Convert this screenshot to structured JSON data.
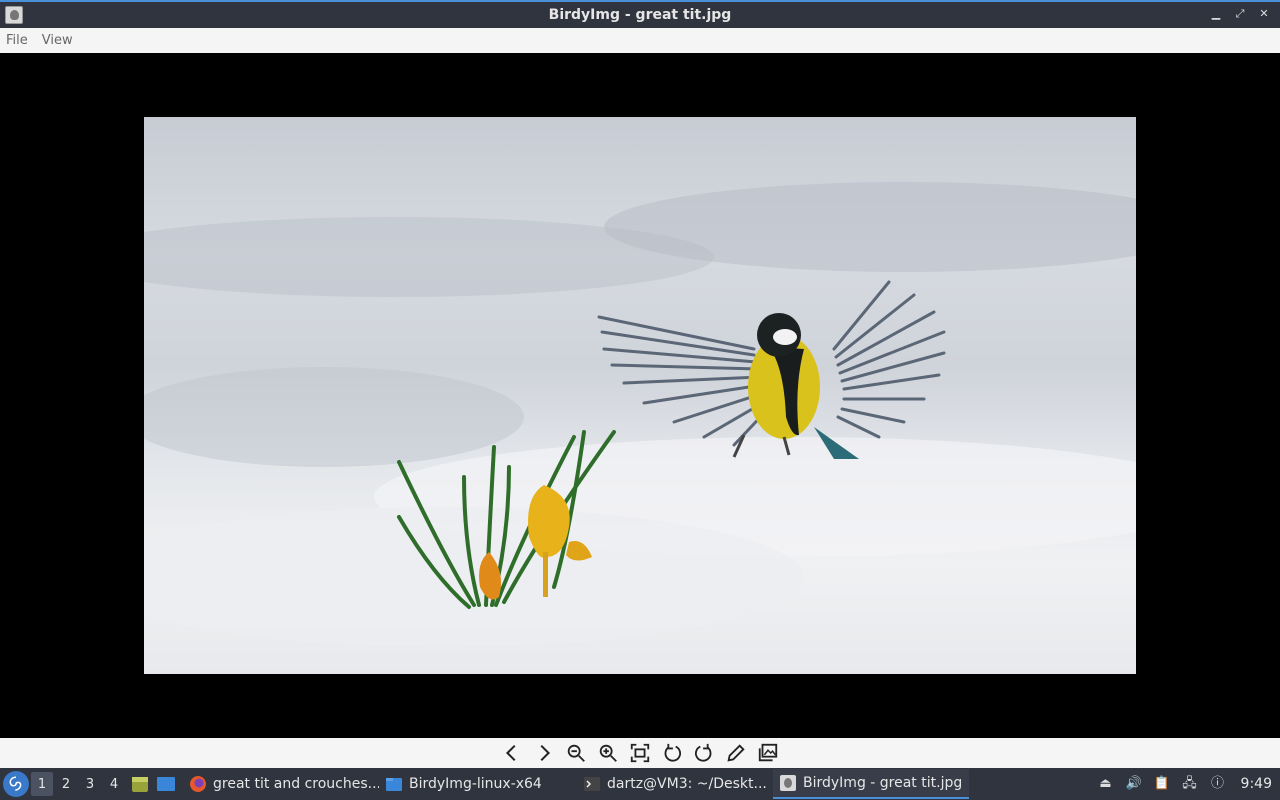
{
  "window": {
    "title": "BirdyImg - great tit.jpg",
    "icons": {
      "app": "birdyimg-app-icon",
      "minimize": "minimize-icon",
      "maximize": "maximize-icon",
      "close": "close-icon"
    }
  },
  "menubar": {
    "items": [
      "File",
      "View"
    ]
  },
  "toolbar": {
    "icons": [
      "prev-arrow-icon",
      "next-arrow-icon",
      "zoom-out-icon",
      "zoom-in-icon",
      "fit-window-icon",
      "rotate-left-icon",
      "rotate-right-icon",
      "edit-pencil-icon",
      "gallery-icon"
    ]
  },
  "taskbar": {
    "desktops": [
      "1",
      "2",
      "3",
      "4"
    ],
    "tasks": [
      {
        "label": "great tit and crouches...",
        "icon": "firefox-icon"
      },
      {
        "label": "BirdyImg-linux-x64",
        "icon": "folder-icon"
      },
      {
        "label": "dartz@VM3: ~/Deskt...",
        "icon": "terminal-icon"
      },
      {
        "label": "BirdyImg - great tit.jpg",
        "icon": "birdyimg-app-icon"
      }
    ],
    "clock": "9:49"
  },
  "colors": {
    "titlebar": "#2f343f",
    "accent": "#4a90d9",
    "bar": "#f5f5f5"
  }
}
